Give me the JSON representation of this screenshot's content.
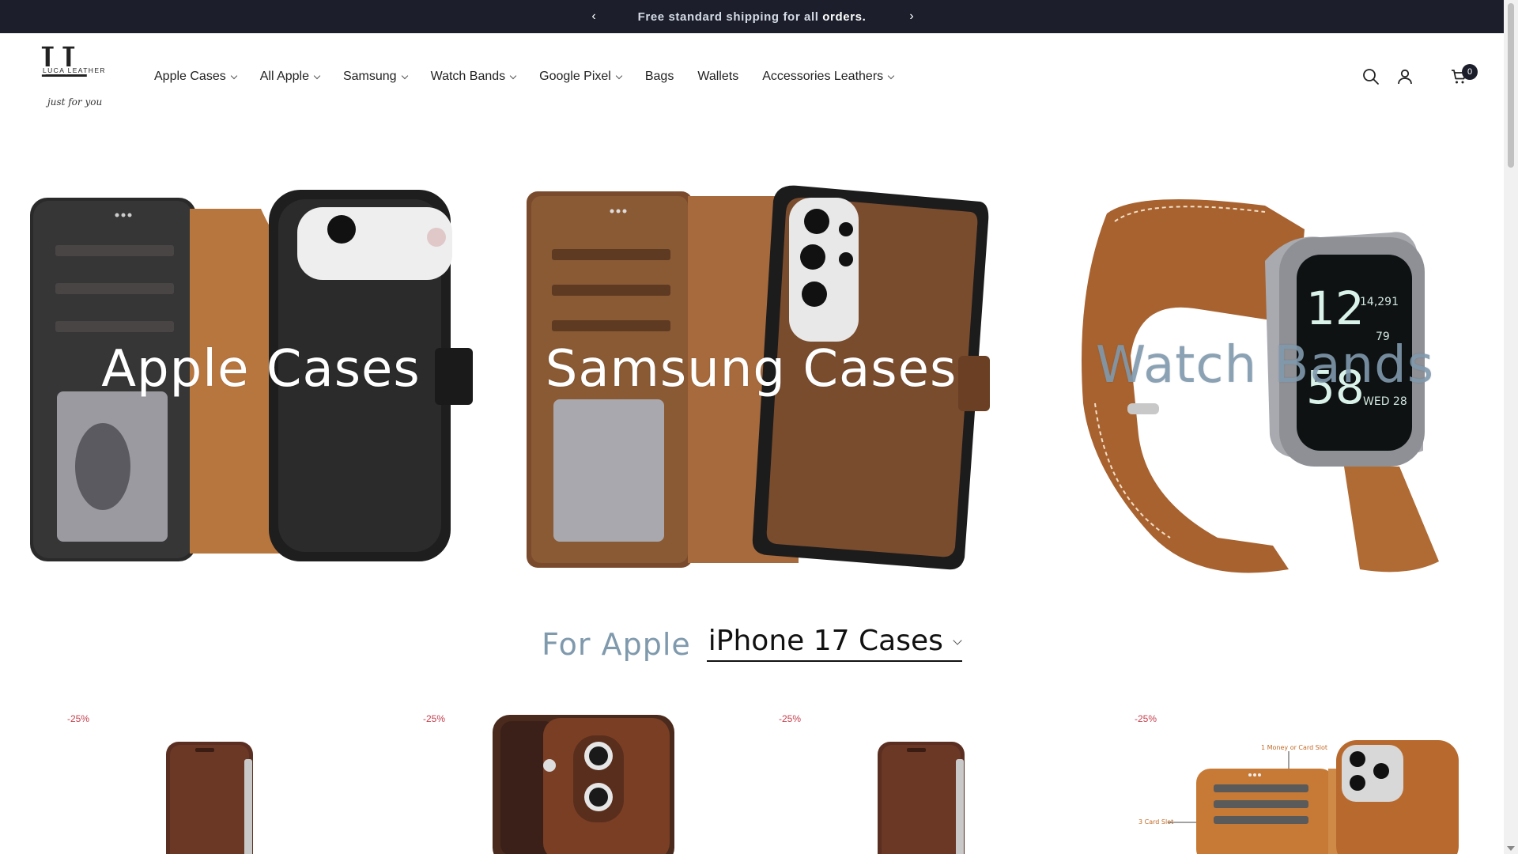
{
  "announcement": {
    "message_part1": "Free standard shipping for all",
    "message_part2": "orders."
  },
  "logo": {
    "letters": "LL",
    "brand": "LUCA LEATHER",
    "tagline": "just for you"
  },
  "nav": {
    "items": [
      {
        "label": "Apple Cases",
        "dropdown": true
      },
      {
        "label": "All Apple",
        "dropdown": true
      },
      {
        "label": "Samsung",
        "dropdown": true
      },
      {
        "label": "Watch Bands",
        "dropdown": true
      },
      {
        "label": "Google Pixel",
        "dropdown": true
      },
      {
        "label": "Bags",
        "dropdown": false
      },
      {
        "label": "Wallets",
        "dropdown": false
      },
      {
        "label": "Accessories Leathers",
        "dropdown": true
      }
    ]
  },
  "header_icons": {
    "search": "search-icon",
    "account": "account-icon",
    "cart": "cart-icon",
    "cart_count": "0"
  },
  "categories": [
    {
      "label": "Apple Cases"
    },
    {
      "label": "Samsung Cases"
    },
    {
      "label": "Watch Bands"
    }
  ],
  "watch_face": {
    "time_hour": "12",
    "time_min": "58",
    "steps": "14,291",
    "heart": "79",
    "date": "WED 28"
  },
  "section": {
    "prefix": "For Apple",
    "selected": "iPhone 17 Cases"
  },
  "products": [
    {
      "badge": "-25%"
    },
    {
      "badge": "-25%"
    },
    {
      "badge": "-25%"
    },
    {
      "badge": "-25%",
      "callout_top": "1 Money or Card Slot",
      "callout_left": "3 Card Slot"
    }
  ],
  "colors": {
    "announcement_bg": "#1c1f2b",
    "accent_blue_grey": "#7f99ad",
    "sale_red": "#c5414f",
    "leather_brown": "#8a5a34",
    "leather_tan": "#b8763f"
  }
}
